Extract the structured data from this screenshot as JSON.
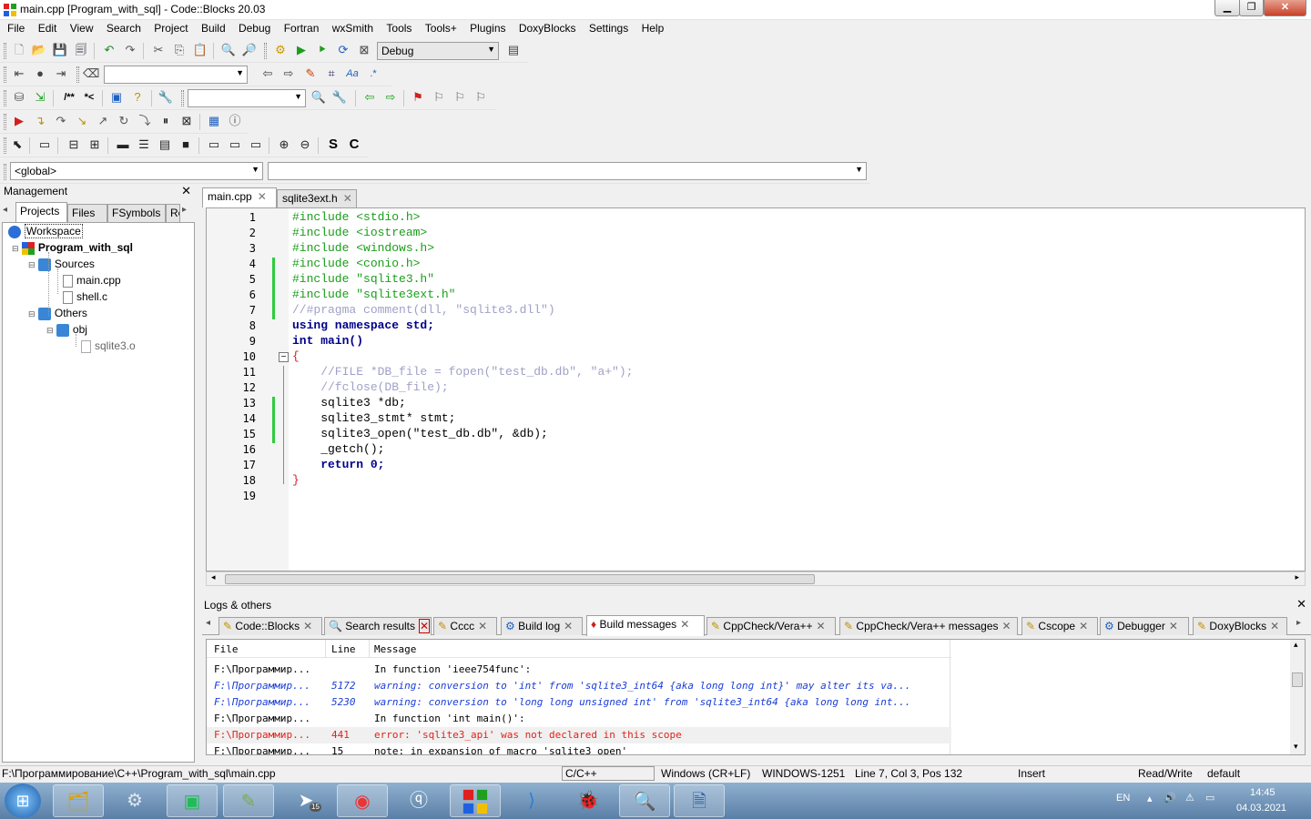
{
  "window": {
    "title": "main.cpp [Program_with_sql] - Code::Blocks 20.03"
  },
  "menu": [
    "File",
    "Edit",
    "View",
    "Search",
    "Project",
    "Build",
    "Debug",
    "Fortran",
    "wxSmith",
    "Tools",
    "Tools+",
    "Plugins",
    "DoxyBlocks",
    "Settings",
    "Help"
  ],
  "toolbar": {
    "build_target": "Debug",
    "scope": "<global>",
    "symbol": "",
    "search_text": ""
  },
  "management": {
    "title": "Management",
    "tabs": [
      "Projects",
      "Files",
      "FSymbols",
      "Re"
    ],
    "tree": {
      "workspace": "Workspace",
      "project": "Program_with_sql",
      "sources": "Sources",
      "files": [
        "main.cpp",
        "shell.c"
      ],
      "others": "Others",
      "obj": "obj",
      "objfile": "sqlite3.o"
    }
  },
  "editor": {
    "tabs": [
      "main.cpp",
      "sqlite3ext.h"
    ],
    "line_numbers": [
      "1",
      "2",
      "3",
      "4",
      "5",
      "6",
      "7",
      "8",
      "9",
      "10",
      "11",
      "12",
      "13",
      "14",
      "15",
      "16",
      "17",
      "18",
      "19"
    ],
    "lines": [
      "#include <stdio.h>",
      "#include <iostream>",
      "#include <windows.h>",
      "#include <conio.h>",
      "#include \"sqlite3.h\"",
      "#include \"sqlite3ext.h\"",
      "//#pragma comment(dll, \"sqlite3.dll\")",
      "using namespace std;",
      "int main()",
      "{",
      "    //FILE *DB_file = fopen(\"test_db.db\", \"a+\");",
      "    //fclose(DB_file);",
      "    sqlite3 *db;",
      "    sqlite3_stmt* stmt;",
      "    sqlite3_open(\"test_db.db\", &db);",
      "    _getch();",
      "    return 0;",
      "}",
      ""
    ]
  },
  "logs": {
    "title": "Logs & others",
    "tabs": [
      "Code::Blocks",
      "Search results",
      "Cccc",
      "Build log",
      "Build messages",
      "CppCheck/Vera++",
      "CppCheck/Vera++ messages",
      "Cscope",
      "Debugger",
      "DoxyBlocks"
    ],
    "columns": [
      "File",
      "Line",
      "Message"
    ],
    "rows": [
      {
        "file": "F:\\Программир...",
        "line": "",
        "message": "In function 'ieee754func':"
      },
      {
        "file": "F:\\Программир...",
        "line": "5172",
        "message": "warning: conversion to 'int' from 'sqlite3_int64 {aka long long int}' may alter its va..."
      },
      {
        "file": "F:\\Программир...",
        "line": "5230",
        "message": "warning: conversion to 'long long unsigned int' from 'sqlite3_int64 {aka long long int..."
      },
      {
        "file": "F:\\Программир...",
        "line": "",
        "message": "In function 'int main()':"
      },
      {
        "file": "F:\\Программир...",
        "line": "441",
        "message": "error: 'sqlite3_api' was not declared in this scope"
      },
      {
        "file": "F:\\Программир...",
        "line": "15",
        "message": "note: in expansion of macro 'sqlite3_open'"
      }
    ]
  },
  "status": {
    "path": "F:\\Программирование\\C++\\Program_with_sql\\main.cpp",
    "lang": "C/C++",
    "eol": "Windows (CR+LF)",
    "encoding": "WINDOWS-1251",
    "position": "Line 7, Col 3, Pos 132",
    "mode": "Insert",
    "access": "Read/Write",
    "profile": "default"
  },
  "taskbar": {
    "lang": "EN",
    "time": "14:45",
    "date": "04.03.2021",
    "badge": "15"
  },
  "colors": {
    "preprocessor": "#1a9e1a",
    "keyword": "#00008b",
    "comment": "#a0a0c8",
    "string": "#1a3dd6",
    "change_marker": "#2ecc40",
    "error": "#e0221b",
    "warning": "#1a3dd6"
  }
}
